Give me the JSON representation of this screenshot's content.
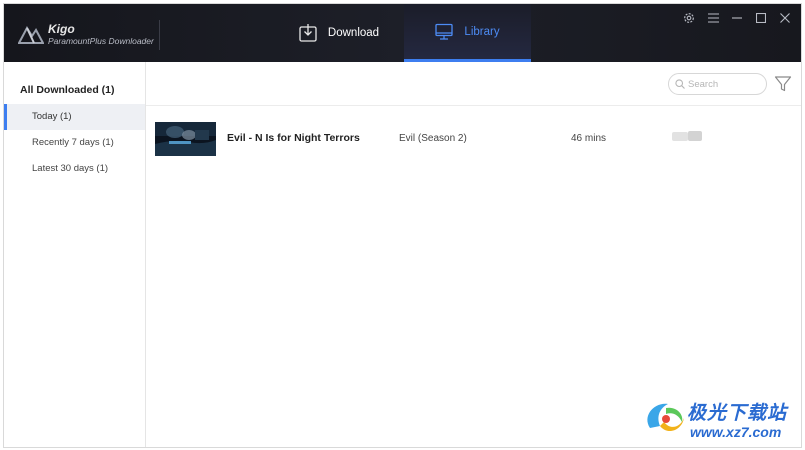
{
  "app": {
    "name": "Kigo",
    "subtitle": "ParamountPlus Downloader"
  },
  "tabs": [
    {
      "label": "Download",
      "icon": "download-icon",
      "active": false
    },
    {
      "label": "Library",
      "icon": "monitor-icon",
      "active": true
    }
  ],
  "window_controls": [
    "gear-icon",
    "menu-icon",
    "minimize-icon",
    "maximize-icon",
    "close-icon"
  ],
  "sidebar": {
    "heading": "All Downloaded (1)",
    "items": [
      {
        "label": "Today (1)",
        "active": true
      },
      {
        "label": "Recently 7 days (1)",
        "active": false
      },
      {
        "label": "Latest 30 days (1)",
        "active": false
      }
    ]
  },
  "search": {
    "placeholder": "Search",
    "value": ""
  },
  "library": {
    "rows": [
      {
        "title": "Evil - N Is for Night Terrors",
        "season": "Evil (Season 2)",
        "duration": "46 mins"
      }
    ]
  },
  "watermark": {
    "text": "极光下载站",
    "url": "www.xz7.com"
  },
  "colors": {
    "accent": "#3d7ef0",
    "titlebar": "#1a1b22",
    "active_item_bg": "#eef0f4"
  }
}
